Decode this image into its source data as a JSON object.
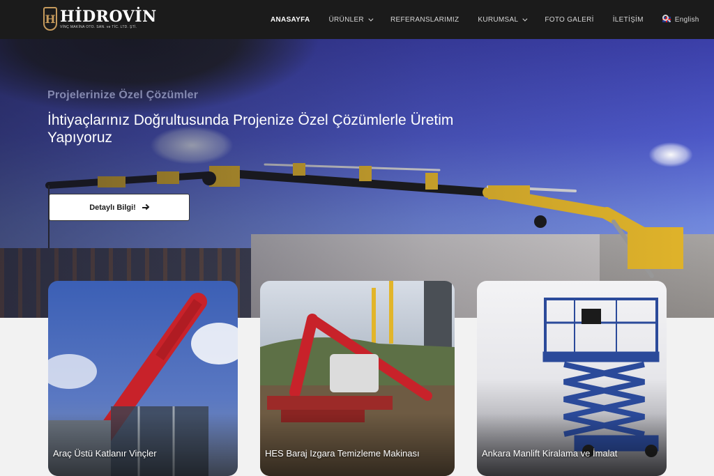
{
  "brand": {
    "name": "HİDROVİN",
    "tagline": "VİNÇ MAKİNA OTO. SAN. ve TİC. LTD. ŞTİ."
  },
  "nav": {
    "items": [
      {
        "label": "ANASAYFA",
        "active": true
      },
      {
        "label": "ÜRÜNLER",
        "dropdown": true
      },
      {
        "label": "REFERANSLARIMIZ"
      },
      {
        "label": "KURUMSAL",
        "dropdown": true
      },
      {
        "label": "FOTO GALERİ"
      },
      {
        "label": "İLETİŞİM"
      }
    ],
    "language": "English"
  },
  "hero": {
    "subtitle": "Projelerinize Özel Çözümler",
    "title": "İhtiyaçlarınız Doğrultusunda Projenize Özel Çözümlerle Üretim Yapıyoruz",
    "button_label": "Detaylı Bilgi!"
  },
  "cards": [
    {
      "label": "Araç Üstü Katlanır Vinçler"
    },
    {
      "label": "HES Baraj Izgara Temizleme Makinası"
    },
    {
      "label": "Ankara Manlift Kiralama ve İmalat"
    }
  ],
  "colors": {
    "header_bg": "#1b1b1b",
    "logo_accent": "#c59a5c",
    "crane_yellow": "#e2b52a",
    "crane_red": "#c8222a",
    "lift_blue": "#2b4a9a"
  }
}
